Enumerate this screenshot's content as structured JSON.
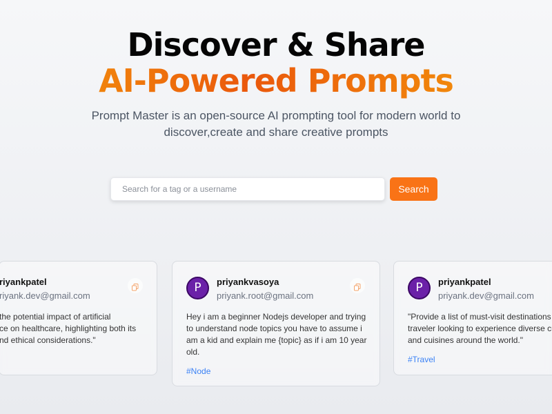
{
  "hero": {
    "title": "Discover & Share",
    "highlight": "AI-Powered Prompts",
    "description": "Prompt Master is an open-source AI prompting tool for modern world to discover,create and share creative prompts"
  },
  "search": {
    "placeholder": "Search for a tag or a username",
    "value": "",
    "button_label": "Search"
  },
  "colors": {
    "accent": "#f97316",
    "avatar": "#6b21a8",
    "tag": "#3b82f6"
  },
  "prompts": [
    {
      "username": "riyankpatel",
      "email": "riyank.dev@gmail.com",
      "text": "the potential impact of artificial\nce on healthcare, highlighting both its\nnd ethical considerations.\"",
      "tag": ""
    },
    {
      "avatar_letter": "P",
      "username": "priyankvasoya",
      "email": "priyank.root@gmail.com",
      "text": "Hey i am a beginner Nodejs developer and trying\nto understand node topics you have to assume i\nam a kid and explain me {topic} as if i am 10 year\nold.",
      "tag": "#Node"
    },
    {
      "avatar_letter": "P",
      "username": "priyankpatel",
      "email": "priyank.dev@gmail.com",
      "text": "\"Provide a list of must-visit destinations f\ntraveler looking to experience diverse cu\nand cuisines around the world.\"",
      "tag": "#Travel"
    }
  ],
  "icons": {
    "copy": "copy-icon"
  }
}
